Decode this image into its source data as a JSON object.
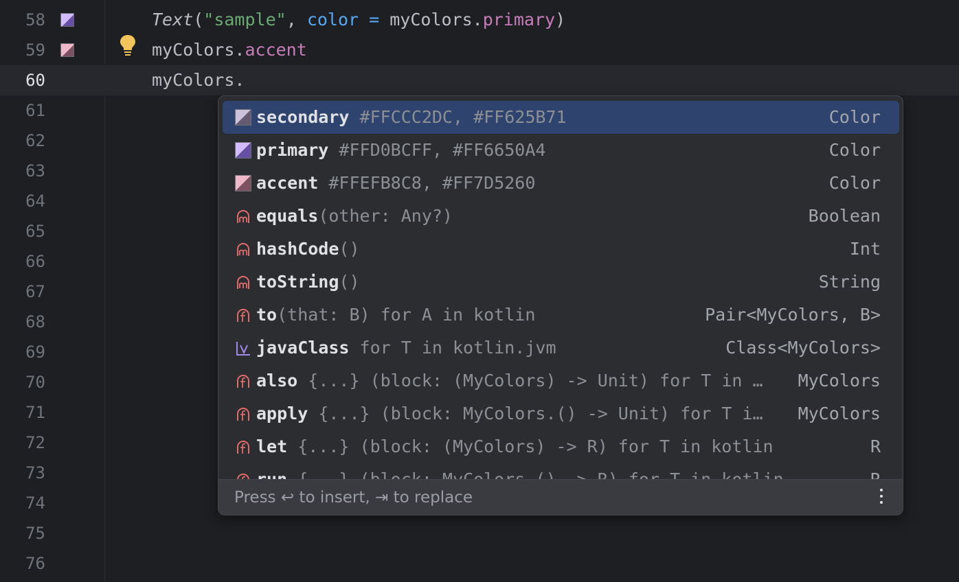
{
  "gutter": {
    "line_numbers": [
      "58",
      "59",
      "60",
      "61",
      "62",
      "63",
      "64",
      "65",
      "66",
      "67",
      "68",
      "69",
      "70",
      "71",
      "72",
      "73",
      "74",
      "75",
      "76"
    ],
    "current_line": "60"
  },
  "code": {
    "line58": {
      "fn": "Text",
      "open": "(",
      "str": "\"sample\"",
      "comma": ", ",
      "param": "color",
      "eq": " = ",
      "obj": "myColors.",
      "prop": "primary",
      "close": ")"
    },
    "line59": {
      "obj": "myColors.",
      "prop": "accent"
    },
    "line60": {
      "obj": "myColors."
    }
  },
  "swatches": {
    "line58": {
      "light": "#D0BCFF",
      "dark": "#6650A4"
    },
    "line59": {
      "light": "#EFB8C8",
      "dark": "#7D5260"
    }
  },
  "completion": {
    "items": [
      {
        "icon": "color-swatch-icon",
        "name": "secondary",
        "tail": " #FFCCC2DC, #FF625B71",
        "type": "Color",
        "light": "#CCC2DC",
        "dark": "#625B71"
      },
      {
        "icon": "color-swatch-icon",
        "name": "primary",
        "tail": " #FFD0BCFF, #FF6650A4",
        "type": "Color",
        "light": "#D0BCFF",
        "dark": "#6650A4"
      },
      {
        "icon": "color-swatch-icon",
        "name": "accent",
        "tail": " #FFEFB8C8, #FF7D5260",
        "type": "Color",
        "light": "#EFB8C8",
        "dark": "#7D5260"
      },
      {
        "icon": "method-icon",
        "name": "equals",
        "tail": "(other: Any?)",
        "type": "Boolean"
      },
      {
        "icon": "method-icon",
        "name": "hashCode",
        "tail": "()",
        "type": "Int"
      },
      {
        "icon": "method-icon",
        "name": "toString",
        "tail": "()",
        "type": "String"
      },
      {
        "icon": "function-icon",
        "name": "to",
        "tail": "(that: B) for A in kotlin",
        "type": "Pair<MyColors, B>"
      },
      {
        "icon": "variable-icon",
        "name": "javaClass",
        "tail": " for T in kotlin.jvm",
        "type": "Class<MyColors>"
      },
      {
        "icon": "function-icon",
        "name": "also",
        "tail": " {...} (block: (MyColors) -> Unit) for T in …",
        "type": "MyColors"
      },
      {
        "icon": "function-icon",
        "name": "apply",
        "tail": " {...} (block: MyColors.() -> Unit) for T i…",
        "type": "MyColors"
      },
      {
        "icon": "function-icon",
        "name": "let",
        "tail": " {...} (block: (MyColors) -> R) for T in kotlin",
        "type": "R"
      },
      {
        "icon": "function-icon",
        "name": "run",
        "tail": " {...} (block: MyColors.() -> R) for T in kotlin",
        "type": "R"
      }
    ],
    "selected_index": 0,
    "footer": "Press ↩ to insert, ⇥ to replace"
  },
  "colors": {
    "selection": "#2E436E",
    "method_icon": "#E06C6C",
    "variable_icon": "#A48AE8"
  }
}
